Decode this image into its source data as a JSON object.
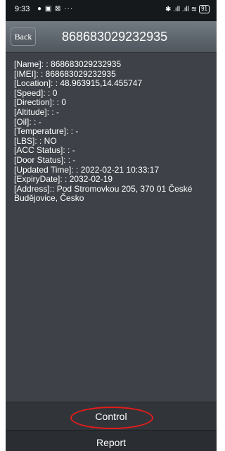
{
  "status_bar": {
    "time": "9:33",
    "left_icons": "● ▣ ⊠ ···",
    "right_icons": "✱ .ıll .ıll ≋",
    "battery": "91"
  },
  "header": {
    "back_label": "Back",
    "title": "868683029232935"
  },
  "details": [
    "[Name]: : 868683029232935",
    "[IMEI]: : 868683029232935",
    "[Location]: : 48.963915,14.455747",
    "[Speed]: : 0",
    "[Direction]: : 0",
    "[Altitude]: : -",
    "[Oil]: : -",
    "[Temperature]: : -",
    "[LBS]: : NO",
    "[ACC Status]: : -",
    "[Door Status]: : -",
    "[Updated Time]: : 2022-02-21 10:33:17",
    "[ExpiryDate]: : 2032-02-19",
    "[Address]:: Pod Stromovkou 205, 370 01 České Budějovice, Česko"
  ],
  "bottom": {
    "control_label": "Control",
    "report_label": "Report"
  },
  "colors": {
    "annotation_circle": "#e41b1b",
    "background": "#3e4248"
  }
}
